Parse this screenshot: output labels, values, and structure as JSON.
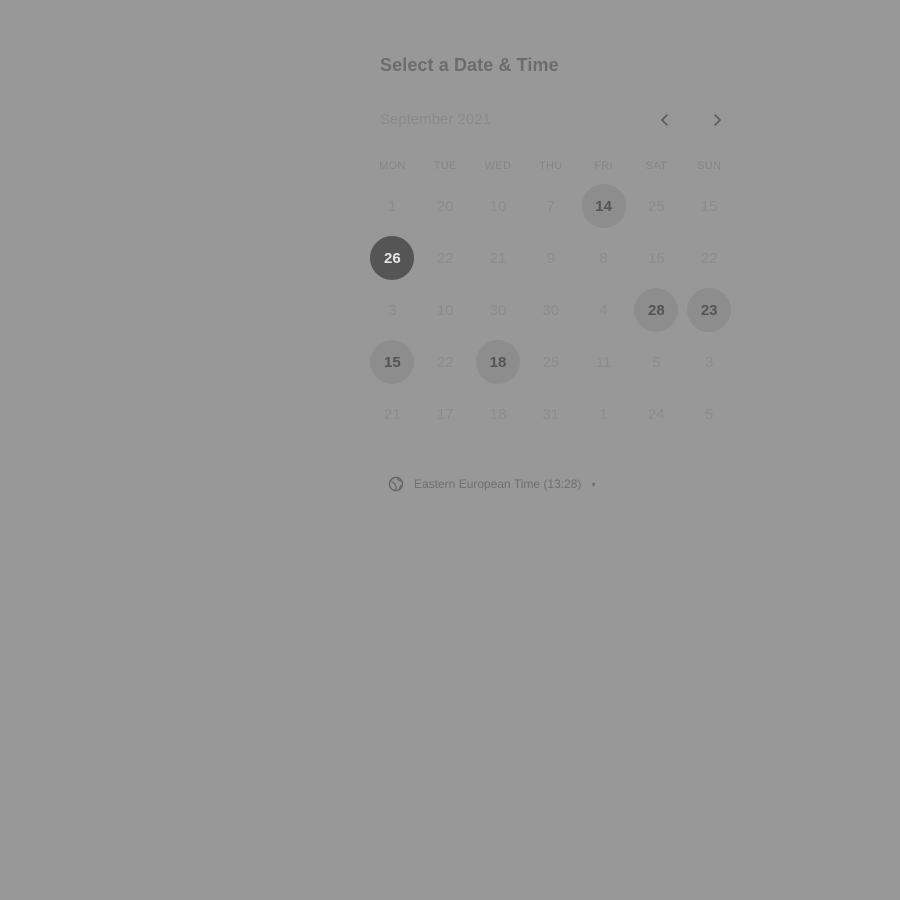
{
  "header": {
    "title": "Select a Date & Time"
  },
  "calendar": {
    "month_label": "September 2021",
    "prev_icon": "chevron-left-icon",
    "next_icon": "chevron-right-icon",
    "weekdays": [
      "MON",
      "TUE",
      "WED",
      "THU",
      "FRI",
      "SAT",
      "SUN"
    ],
    "rows": [
      [
        {
          "label": "1",
          "state": "disabled"
        },
        {
          "label": "20",
          "state": "disabled"
        },
        {
          "label": "10",
          "state": "disabled"
        },
        {
          "label": "7",
          "state": "disabled"
        },
        {
          "label": "14",
          "state": "available"
        },
        {
          "label": "25",
          "state": "disabled"
        },
        {
          "label": "15",
          "state": "disabled"
        }
      ],
      [
        {
          "label": "26",
          "state": "selected"
        },
        {
          "label": "22",
          "state": "disabled"
        },
        {
          "label": "21",
          "state": "disabled"
        },
        {
          "label": "9",
          "state": "disabled"
        },
        {
          "label": "8",
          "state": "disabled"
        },
        {
          "label": "15",
          "state": "disabled"
        },
        {
          "label": "22",
          "state": "disabled"
        }
      ],
      [
        {
          "label": "3",
          "state": "disabled"
        },
        {
          "label": "10",
          "state": "disabled"
        },
        {
          "label": "30",
          "state": "disabled"
        },
        {
          "label": "30",
          "state": "disabled"
        },
        {
          "label": "4",
          "state": "disabled"
        },
        {
          "label": "28",
          "state": "available"
        },
        {
          "label": "23",
          "state": "available"
        }
      ],
      [
        {
          "label": "15",
          "state": "available"
        },
        {
          "label": "22",
          "state": "disabled"
        },
        {
          "label": "18",
          "state": "available"
        },
        {
          "label": "25",
          "state": "disabled"
        },
        {
          "label": "11",
          "state": "disabled"
        },
        {
          "label": "5",
          "state": "disabled"
        },
        {
          "label": "3",
          "state": "disabled"
        }
      ],
      [
        {
          "label": "21",
          "state": "disabled"
        },
        {
          "label": "17",
          "state": "disabled"
        },
        {
          "label": "18",
          "state": "disabled"
        },
        {
          "label": "31",
          "state": "disabled"
        },
        {
          "label": "1",
          "state": "disabled"
        },
        {
          "label": "24",
          "state": "disabled"
        },
        {
          "label": "5",
          "state": "disabled"
        }
      ]
    ]
  },
  "timezone": {
    "icon": "globe-icon",
    "label": "Eastern European Time (13:28)",
    "caret": "▾"
  }
}
